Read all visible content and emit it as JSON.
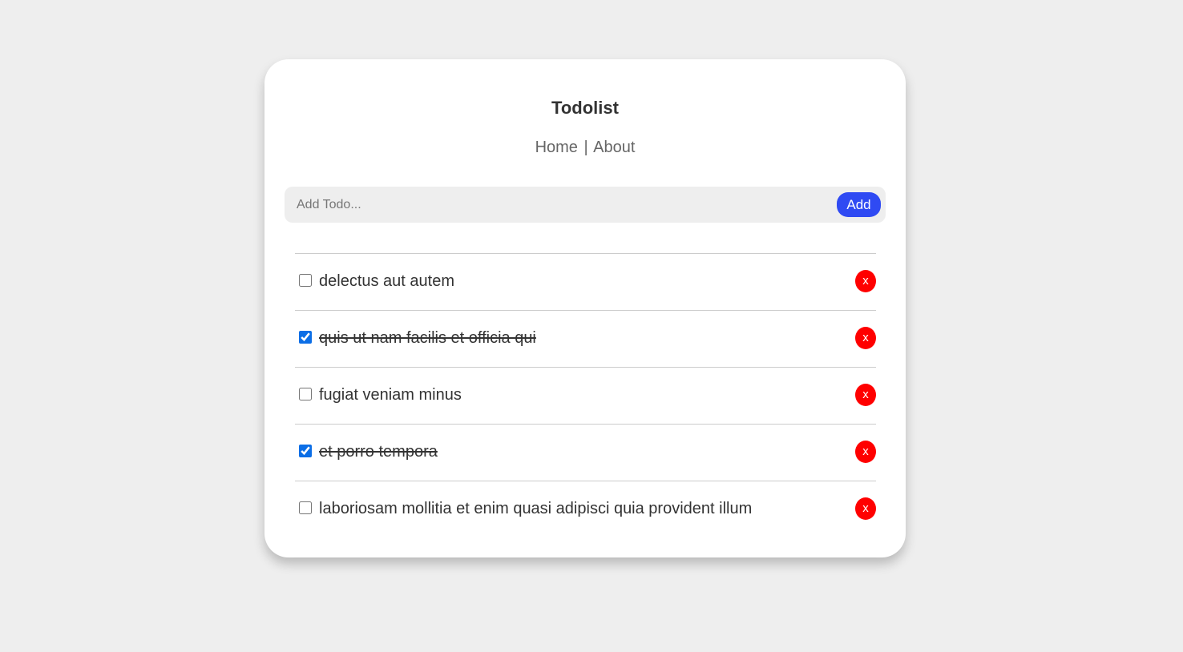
{
  "header": {
    "title": "Todolist",
    "nav": {
      "home": "Home",
      "separator": "|",
      "about": "About"
    }
  },
  "add_form": {
    "placeholder": "Add Todo...",
    "value": "",
    "button_label": "Add"
  },
  "todos": [
    {
      "title": "delectus aut autem",
      "completed": false,
      "delete_label": "x"
    },
    {
      "title": "quis ut nam facilis et officia qui",
      "completed": true,
      "delete_label": "x"
    },
    {
      "title": "fugiat veniam minus",
      "completed": false,
      "delete_label": "x"
    },
    {
      "title": "et porro tempora",
      "completed": true,
      "delete_label": "x"
    },
    {
      "title": "laboriosam mollitia et enim quasi adipisci quia provident illum",
      "completed": false,
      "delete_label": "x"
    }
  ],
  "colors": {
    "background": "#eeeeee",
    "card": "#ffffff",
    "accent_button": "#2f4af3",
    "delete_button": "#ff0000",
    "text": "#333333",
    "checkbox": "#0b6ee6"
  }
}
